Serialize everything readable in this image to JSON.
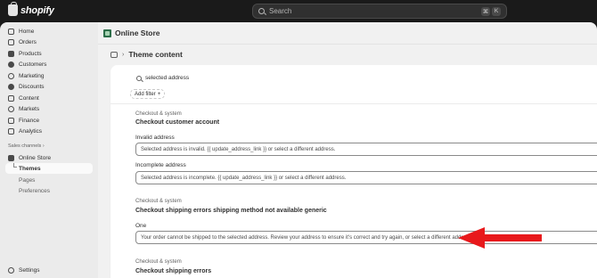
{
  "topbar": {
    "logo_text": "shopify",
    "search_placeholder": "Search",
    "shortcut_keys": [
      "⌘",
      "K"
    ]
  },
  "sidebar": {
    "items": [
      {
        "label": "Home",
        "icon": "home-icon"
      },
      {
        "label": "Orders",
        "icon": "orders-icon"
      },
      {
        "label": "Products",
        "icon": "tag-icon"
      },
      {
        "label": "Customers",
        "icon": "person-icon"
      },
      {
        "label": "Marketing",
        "icon": "target-icon"
      },
      {
        "label": "Discounts",
        "icon": "discount-icon"
      },
      {
        "label": "Content",
        "icon": "content-icon"
      },
      {
        "label": "Markets",
        "icon": "globe-icon"
      },
      {
        "label": "Finance",
        "icon": "bank-icon"
      },
      {
        "label": "Analytics",
        "icon": "chart-icon"
      }
    ],
    "sales_channels_label": "Sales channels",
    "online_store_label": "Online Store",
    "sub_items": [
      "Themes",
      "Pages",
      "Preferences"
    ],
    "settings_label": "Settings"
  },
  "main": {
    "page_title": "Online Store",
    "breadcrumb": "Theme content",
    "search_value": "selected address",
    "add_filter_label": "Add filter",
    "sections": [
      {
        "category": "Checkout & system",
        "title": "Checkout customer account",
        "fields": [
          {
            "label": "Invalid address",
            "value": "Selected address is invalid. {{ update_address_link }} or select a different address."
          },
          {
            "label": "Incomplete address",
            "value": "Selected address is incomplete. {{ update_address_link }} or select a different address."
          }
        ]
      },
      {
        "category": "Checkout & system",
        "title": "Checkout shipping errors shipping method not available generic",
        "fields": [
          {
            "label": "One",
            "value": "Your order cannot be shipped to the selected address. Review your address to ensure it's correct and try again, or select a different address."
          }
        ]
      },
      {
        "category": "Checkout & system",
        "title": "Checkout shipping errors",
        "fields": []
      }
    ]
  },
  "colors": {
    "topbar_bg": "#1a1a1a",
    "sidebar_bg": "#ebebeb",
    "main_bg": "#f1f1f1",
    "arrow": "#e8191c"
  }
}
